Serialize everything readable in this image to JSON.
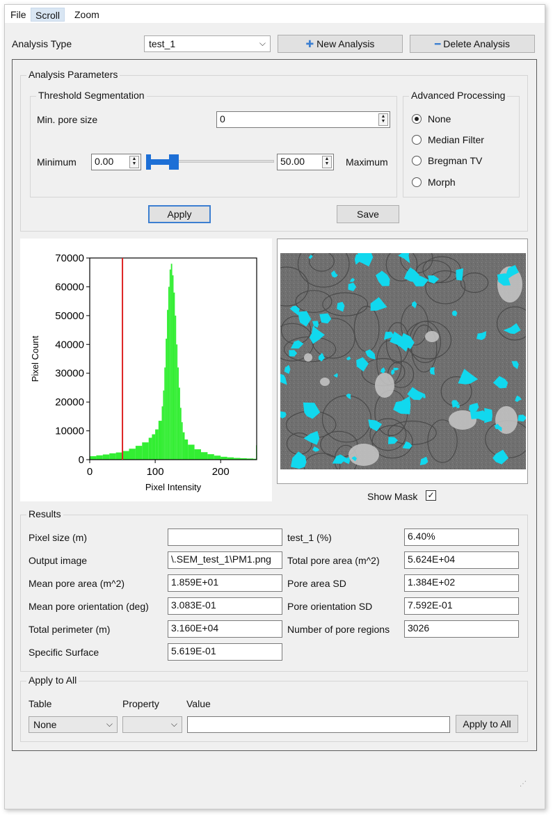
{
  "menu": [
    "File",
    "Scroll",
    "Zoom"
  ],
  "analysis": {
    "type_label": "Analysis Type",
    "selected": "test_1",
    "new_label": "New Analysis",
    "delete_label": "Delete Analysis"
  },
  "params": {
    "title": "Analysis Parameters",
    "threshold_title": "Threshold Segmentation",
    "min_pore_label": "Min. pore size",
    "min_pore_value": "0",
    "minimum_label": "Minimum",
    "minimum_value": "0.00",
    "maximum_label": "Maximum",
    "maximum_value": "50.00",
    "apply_label": "Apply",
    "save_label": "Save",
    "advanced_title": "Advanced Processing",
    "advanced_options": [
      "None",
      "Median Filter",
      "Bregman TV",
      "Morph"
    ],
    "advanced_selected": "None"
  },
  "chart_data": {
    "type": "bar",
    "xlabel": "Pixel Intensity",
    "ylabel": "Pixel Count",
    "xlim": [
      0,
      255
    ],
    "ylim": [
      0,
      70000
    ],
    "xticks": [
      "0",
      "100",
      "200"
    ],
    "yticks": [
      "0",
      "10000",
      "20000",
      "30000",
      "40000",
      "50000",
      "60000",
      "70000"
    ],
    "threshold_line": 50,
    "bar_color": "#33ee33",
    "line_color": "#dd2222",
    "x": [
      0,
      10,
      20,
      30,
      40,
      50,
      60,
      70,
      80,
      90,
      95,
      100,
      105,
      110,
      112,
      114,
      116,
      118,
      120,
      122,
      124,
      126,
      128,
      130,
      132,
      134,
      136,
      138,
      140,
      142,
      145,
      150,
      160,
      170,
      180,
      190,
      200,
      210,
      220,
      230,
      240,
      250,
      254
    ],
    "values": [
      1200,
      1500,
      1800,
      2200,
      2500,
      3000,
      3800,
      4800,
      6000,
      7600,
      8800,
      10500,
      13500,
      18500,
      24000,
      32000,
      42000,
      52000,
      60000,
      66000,
      68000,
      64000,
      58000,
      50000,
      40000,
      32000,
      25000,
      18000,
      13000,
      9500,
      7000,
      5200,
      3600,
      2600,
      1900,
      1400,
      1000,
      800,
      600,
      500,
      400,
      300,
      5000
    ]
  },
  "show_mask_label": "Show Mask",
  "results": {
    "title": "Results",
    "left": [
      {
        "label": "Pixel size (m)",
        "value": ""
      },
      {
        "label": "Output image",
        "value": "\\.SEM_test_1\\PM1.png"
      },
      {
        "label": "Mean pore area (m^2)",
        "value": "1.859E+01"
      },
      {
        "label": "Mean pore orientation (deg)",
        "value": "3.083E-01"
      },
      {
        "label": "Total perimeter (m)",
        "value": "3.160E+04"
      },
      {
        "label": "Specific Surface",
        "value": "5.619E-01"
      }
    ],
    "right": [
      {
        "label": "test_1 (%)",
        "value": "6.40%"
      },
      {
        "label": "Total pore area (m^2)",
        "value": "5.624E+04"
      },
      {
        "label": "Pore area SD",
        "value": "1.384E+02"
      },
      {
        "label": "Pore orientation SD",
        "value": "7.592E-01"
      },
      {
        "label": "Number of pore regions",
        "value": "3026"
      }
    ]
  },
  "apply_all": {
    "title": "Apply to All",
    "table_label": "Table",
    "property_label": "Property",
    "value_label": "Value",
    "table_selected": "None",
    "property_selected": "",
    "value": "",
    "button_label": "Apply to All"
  },
  "colors": {
    "accent": "#3c7fd1",
    "mask": "#11d8ee",
    "slider": "#1d6fd6"
  }
}
